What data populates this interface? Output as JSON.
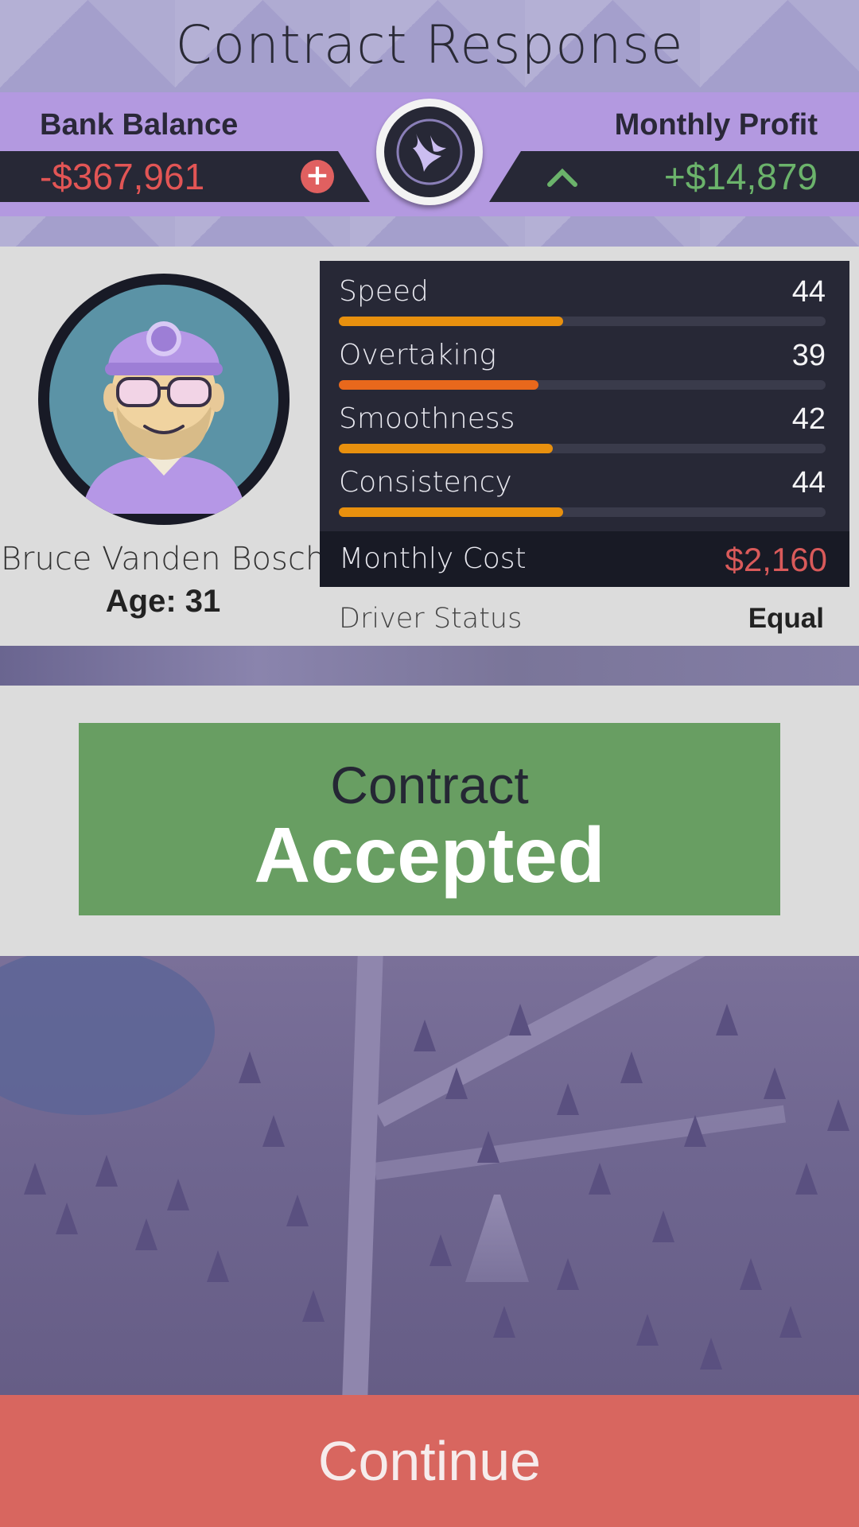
{
  "header": {
    "title": "Contract Response"
  },
  "finance": {
    "bank_label": "Bank Balance",
    "bank_value": "-$367,961",
    "profit_label": "Monthly Profit",
    "profit_value": "+$14,879",
    "add_icon": "plus-icon",
    "trend_icon": "chevron-up-icon"
  },
  "driver": {
    "name": "Bruce Vanden Bosch",
    "age": "Age: 31",
    "stats": [
      {
        "label": "Speed",
        "value": "44",
        "fraction": 0.46,
        "color": "#e8900e"
      },
      {
        "label": "Overtaking",
        "value": "39",
        "fraction": 0.41,
        "color": "#e8681c"
      },
      {
        "label": "Smoothness",
        "value": "42",
        "fraction": 0.44,
        "color": "#e8900e"
      },
      {
        "label": "Consistency",
        "value": "44",
        "fraction": 0.46,
        "color": "#e8900e"
      }
    ],
    "cost_label": "Monthly Cost",
    "cost_value": "$2,160",
    "status_label": "Driver Status",
    "status_value": "Equal"
  },
  "result": {
    "top": "Contract",
    "main": "Accepted"
  },
  "continue_label": "Continue",
  "colors": {
    "accent_purple": "#b399e0",
    "negative": "#e25555",
    "positive": "#6bb36b",
    "accepted": "#689e62",
    "continue": "#d8665f"
  }
}
